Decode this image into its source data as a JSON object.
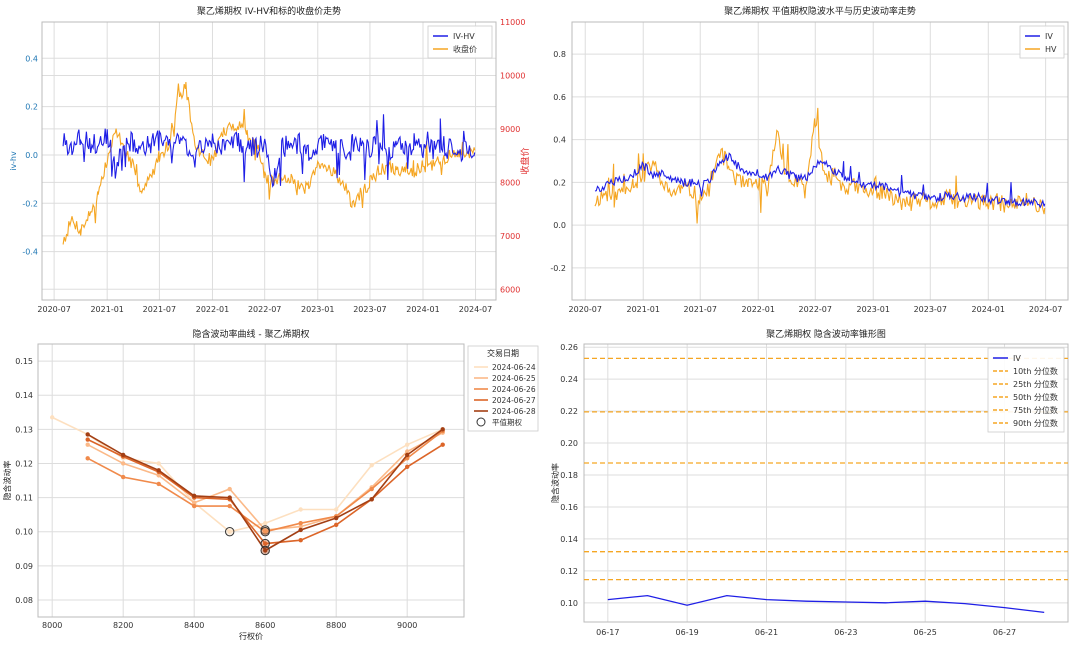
{
  "colors": {
    "blue": "#1f1fe6",
    "orange": "#f5a623",
    "red": "#e03030",
    "grid": "#dddddd",
    "frame": "#bbbbbb",
    "ringDark": "#333333",
    "cyanTick": "#1f77b4"
  },
  "chart_data": [
    {
      "id": "ivhv",
      "type": "line",
      "title": "聚乙烯期权 IV-HV和标的收盘价走势",
      "ylabel": "iv-hv",
      "y2label": "收盘价",
      "ylim": [
        -0.6,
        0.55
      ],
      "y2lim": [
        5800,
        11000
      ],
      "yticks": [
        "-0.4",
        "-0.2",
        "0.0",
        "0.2",
        "0.4"
      ],
      "y2ticks": [
        "6000",
        "7000",
        "8000",
        "9000",
        "10000",
        "11000"
      ],
      "xticks": [
        "2020-07",
        "2021-01",
        "2021-07",
        "2022-01",
        "2022-07",
        "2023-01",
        "2023-07",
        "2024-01",
        "2024-07"
      ],
      "grid": true,
      "legend_position": "top-right",
      "series": [
        {
          "name": "IV-HV",
          "axis": "left",
          "x": [
            "2020-08-01",
            "2020-09-01",
            "2020-10-01",
            "2020-11-01",
            "2020-12-01",
            "2021-01-01",
            "2021-02-01",
            "2021-03-01",
            "2021-04-01",
            "2021-05-01",
            "2021-06-01",
            "2021-07-01",
            "2021-08-01",
            "2021-09-01",
            "2021-10-01",
            "2021-11-01",
            "2021-12-01",
            "2022-01-01",
            "2022-02-01",
            "2022-03-01",
            "2022-04-01",
            "2022-05-01",
            "2022-06-01",
            "2022-07-01",
            "2022-08-01",
            "2022-09-01",
            "2022-10-01",
            "2022-11-01",
            "2022-12-01",
            "2023-01-01",
            "2023-02-01",
            "2023-03-01",
            "2023-04-01",
            "2023-05-01",
            "2023-06-01",
            "2023-07-01",
            "2023-08-01",
            "2023-09-01",
            "2023-10-01",
            "2023-11-01",
            "2023-12-01",
            "2024-01-01",
            "2024-02-01",
            "2024-03-01",
            "2024-04-01",
            "2024-05-01",
            "2024-06-28"
          ],
          "y": [
            0.06,
            0.03,
            0.08,
            0.05,
            0.04,
            0.08,
            -0.08,
            0.07,
            0.05,
            0.03,
            0.04,
            0.06,
            0.05,
            0.07,
            0.04,
            -0.02,
            0.05,
            0.06,
            0.02,
            0.08,
            0.05,
            0.04,
            0.03,
            0.05,
            -0.1,
            0.04,
            0.03,
            0.05,
            0.02,
            0.03,
            0.05,
            0.04,
            0.02,
            0.05,
            0.04,
            0.03,
            0.05,
            0.02,
            0.04,
            0.03,
            0.05,
            0.03,
            0.02,
            0.04,
            0.03,
            0.02,
            0.01
          ]
        },
        {
          "name": "收盘价",
          "axis": "right",
          "x": [
            "2020-08-01",
            "2020-09-01",
            "2020-10-01",
            "2020-11-01",
            "2020-12-01",
            "2021-01-01",
            "2021-02-01",
            "2021-03-01",
            "2021-04-01",
            "2021-05-01",
            "2021-06-01",
            "2021-07-01",
            "2021-08-01",
            "2021-09-01",
            "2021-10-01",
            "2021-11-01",
            "2021-12-01",
            "2022-01-01",
            "2022-02-01",
            "2022-03-01",
            "2022-04-01",
            "2022-05-01",
            "2022-06-01",
            "2022-07-01",
            "2022-08-01",
            "2022-09-01",
            "2022-10-01",
            "2022-11-01",
            "2022-12-01",
            "2023-01-01",
            "2023-02-01",
            "2023-03-01",
            "2023-04-01",
            "2023-05-01",
            "2023-06-01",
            "2023-07-01",
            "2023-08-01",
            "2023-09-01",
            "2023-10-01",
            "2023-11-01",
            "2023-12-01",
            "2024-01-01",
            "2024-02-01",
            "2024-03-01",
            "2024-04-01",
            "2024-05-01",
            "2024-06-28"
          ],
          "y": [
            6900,
            7300,
            7100,
            7400,
            7800,
            8400,
            9000,
            8600,
            8300,
            7800,
            8100,
            8500,
            8700,
            9500,
            9800,
            8700,
            8500,
            8400,
            8900,
            9000,
            9100,
            8900,
            8800,
            8100,
            8000,
            8100,
            8100,
            7900,
            7900,
            8300,
            8300,
            8200,
            7900,
            7600,
            7800,
            8000,
            8200,
            8300,
            8200,
            8300,
            8200,
            8300,
            8300,
            8400,
            8500,
            8500,
            8600
          ]
        }
      ]
    },
    {
      "id": "atm",
      "type": "line",
      "title": "聚乙烯期权 平值期权隐波水平与历史波动率走势",
      "ylim": [
        -0.35,
        0.95
      ],
      "yticks": [
        "-0.2",
        "0.0",
        "0.2",
        "0.4",
        "0.6",
        "0.8"
      ],
      "xticks": [
        "2020-07",
        "2021-01",
        "2021-07",
        "2022-01",
        "2022-07",
        "2023-01",
        "2023-07",
        "2024-01",
        "2024-07"
      ],
      "grid": true,
      "legend_position": "top-right",
      "series": [
        {
          "name": "IV",
          "x": [
            "2020-08-01",
            "2020-09-01",
            "2020-10-01",
            "2020-11-01",
            "2020-12-01",
            "2021-01-01",
            "2021-02-01",
            "2021-03-01",
            "2021-04-01",
            "2021-05-01",
            "2021-06-01",
            "2021-07-01",
            "2021-08-01",
            "2021-09-01",
            "2021-10-01",
            "2021-11-01",
            "2021-12-01",
            "2022-01-01",
            "2022-02-01",
            "2022-03-01",
            "2022-04-01",
            "2022-05-01",
            "2022-06-01",
            "2022-07-01",
            "2022-08-01",
            "2022-09-01",
            "2022-10-01",
            "2022-11-01",
            "2022-12-01",
            "2023-01-01",
            "2023-02-01",
            "2023-03-01",
            "2023-04-01",
            "2023-05-01",
            "2023-06-01",
            "2023-07-01",
            "2023-08-01",
            "2023-09-01",
            "2023-10-01",
            "2023-11-01",
            "2023-12-01",
            "2024-01-01",
            "2024-02-01",
            "2024-03-01",
            "2024-04-01",
            "2024-05-01",
            "2024-06-28"
          ],
          "y": [
            0.17,
            0.18,
            0.2,
            0.22,
            0.24,
            0.28,
            0.23,
            0.25,
            0.22,
            0.2,
            0.2,
            0.19,
            0.21,
            0.3,
            0.32,
            0.27,
            0.25,
            0.24,
            0.22,
            0.27,
            0.24,
            0.22,
            0.22,
            0.28,
            0.3,
            0.25,
            0.22,
            0.2,
            0.19,
            0.18,
            0.18,
            0.17,
            0.15,
            0.14,
            0.14,
            0.13,
            0.13,
            0.14,
            0.13,
            0.13,
            0.13,
            0.12,
            0.12,
            0.11,
            0.11,
            0.11,
            0.1
          ]
        },
        {
          "name": "HV",
          "x": [
            "2020-08-01",
            "2020-09-01",
            "2020-10-01",
            "2020-11-01",
            "2020-12-01",
            "2021-01-01",
            "2021-02-01",
            "2021-03-01",
            "2021-04-01",
            "2021-05-01",
            "2021-06-01",
            "2021-07-01",
            "2021-08-01",
            "2021-09-01",
            "2021-10-01",
            "2021-11-01",
            "2021-12-01",
            "2022-01-01",
            "2022-02-01",
            "2022-03-01",
            "2022-04-01",
            "2022-05-01",
            "2022-06-01",
            "2022-07-01",
            "2022-08-01",
            "2022-09-01",
            "2022-10-01",
            "2022-11-01",
            "2022-12-01",
            "2023-01-01",
            "2023-02-01",
            "2023-03-01",
            "2023-04-01",
            "2023-05-01",
            "2023-06-01",
            "2023-07-01",
            "2023-08-01",
            "2023-09-01",
            "2023-10-01",
            "2023-11-01",
            "2023-12-01",
            "2024-01-01",
            "2024-02-01",
            "2024-03-01",
            "2024-04-01",
            "2024-05-01",
            "2024-06-28"
          ],
          "y": [
            0.11,
            0.15,
            0.12,
            0.18,
            0.2,
            0.22,
            0.3,
            0.18,
            0.15,
            0.17,
            0.16,
            0.14,
            0.16,
            0.35,
            0.27,
            0.2,
            0.18,
            0.2,
            0.17,
            0.45,
            0.22,
            0.2,
            0.16,
            0.5,
            0.2,
            0.24,
            0.18,
            0.18,
            0.16,
            0.14,
            0.16,
            0.12,
            0.11,
            0.1,
            0.12,
            0.1,
            0.11,
            0.13,
            0.1,
            0.12,
            0.11,
            0.1,
            0.11,
            0.09,
            0.1,
            0.12,
            0.08
          ]
        }
      ]
    },
    {
      "id": "smile",
      "type": "line",
      "title": "隐含波动率曲线 - 聚乙烯期权",
      "xlabel": "行权价",
      "ylabel": "隐含波动率",
      "xlim": [
        7960,
        9160
      ],
      "ylim": [
        0.075,
        0.155
      ],
      "xticks": [
        8000,
        8200,
        8400,
        8600,
        8800,
        9000
      ],
      "xtick_labels": [
        "8000",
        "8200",
        "8400",
        "8600",
        "8800",
        "9000"
      ],
      "yticks": [
        0.08,
        0.09,
        0.1,
        0.11,
        0.12,
        0.13,
        0.14,
        0.15
      ],
      "ytick_labels": [
        "0.08",
        "0.09",
        "0.10",
        "0.11",
        "0.12",
        "0.13",
        "0.14",
        "0.15"
      ],
      "grid": true,
      "legend_title": "交易日期",
      "legend_position": "outside-right",
      "atm_label": "平值期权",
      "series": [
        {
          "name": "2024-06-24",
          "color": "#fde0c0",
          "x": [
            8000,
            8100,
            8200,
            8300,
            8400,
            8500,
            8600,
            8700,
            8800,
            8900,
            9000,
            9100
          ],
          "y": [
            0.1335,
            0.1285,
            0.1215,
            0.12,
            0.1085,
            0.1,
            0.1025,
            0.1065,
            0.1065,
            0.1195,
            0.1255,
            0.13
          ],
          "atm": [
            8500,
            0.1
          ]
        },
        {
          "name": "2024-06-25",
          "color": "#fbb988",
          "x": [
            8100,
            8200,
            8300,
            8400,
            8500,
            8600,
            8700,
            8800,
            8900,
            9000,
            9100
          ],
          "y": [
            0.1255,
            0.12,
            0.1165,
            0.1085,
            0.1125,
            0.1005,
            0.1015,
            0.1045,
            0.113,
            0.1235,
            0.129
          ],
          "atm": [
            8600,
            0.1005
          ]
        },
        {
          "name": "2024-06-26",
          "color": "#f08a4b",
          "x": [
            8100,
            8200,
            8300,
            8400,
            8500,
            8600,
            8700,
            8800,
            8900,
            9000,
            9100
          ],
          "y": [
            0.1215,
            0.116,
            0.114,
            0.1075,
            0.1075,
            0.1,
            0.1025,
            0.1045,
            0.1125,
            0.1215,
            0.1295
          ],
          "atm": [
            8600,
            0.1
          ]
        },
        {
          "name": "2024-06-27",
          "color": "#dc6528",
          "x": [
            8100,
            8200,
            8300,
            8400,
            8500,
            8600,
            8700,
            8800,
            8900,
            9000,
            9100
          ],
          "y": [
            0.127,
            0.122,
            0.1175,
            0.11,
            0.1095,
            0.0965,
            0.0975,
            0.102,
            0.1095,
            0.119,
            0.1255
          ],
          "atm": [
            8600,
            0.0965
          ]
        },
        {
          "name": "2024-06-28",
          "color": "#a33f14",
          "x": [
            8100,
            8200,
            8300,
            8400,
            8500,
            8600,
            8700,
            8800,
            8900,
            9000,
            9100
          ],
          "y": [
            0.1285,
            0.1225,
            0.118,
            0.1105,
            0.11,
            0.0945,
            0.1005,
            0.104,
            0.1095,
            0.1225,
            0.13
          ],
          "atm": [
            8600,
            0.0945
          ]
        }
      ]
    },
    {
      "id": "cone",
      "type": "line",
      "title": "聚乙烯期权 隐含波动率锥形图",
      "ylabel": "隐含波动率",
      "ylim": [
        0.088,
        0.262
      ],
      "yticks": [
        0.1,
        0.12,
        0.14,
        0.16,
        0.18,
        0.2,
        0.22,
        0.24,
        0.26
      ],
      "ytick_labels": [
        "0.10",
        "0.12",
        "0.14",
        "0.16",
        "0.18",
        "0.20",
        "0.22",
        "0.24",
        "0.26"
      ],
      "xticks": [
        "06-17",
        "06-19",
        "06-21",
        "06-23",
        "06-25",
        "06-27"
      ],
      "grid": true,
      "legend_position": "top-right",
      "series": [
        {
          "name": "IV",
          "color": "#1f1fe6",
          "x": [
            "06-17",
            "06-18",
            "06-19",
            "06-20",
            "06-21",
            "06-22",
            "06-23",
            "06-24",
            "06-25",
            "06-26",
            "06-27",
            "06-28"
          ],
          "y": [
            0.102,
            0.1045,
            0.0985,
            0.1045,
            0.102,
            0.101,
            0.1005,
            0.1,
            0.101,
            0.0995,
            0.097,
            0.094
          ]
        }
      ],
      "percentiles": [
        {
          "name": "10th 分位数",
          "value": 0.1145
        },
        {
          "name": "25th 分位数",
          "value": 0.132
        },
        {
          "name": "50th 分位数",
          "value": 0.1875
        },
        {
          "name": "75th 分位数",
          "value": 0.2195
        },
        {
          "name": "90th 分位数",
          "value": 0.253
        }
      ]
    }
  ]
}
